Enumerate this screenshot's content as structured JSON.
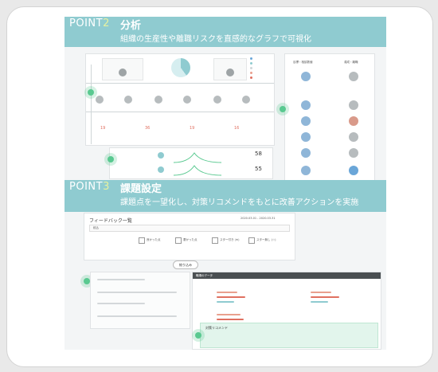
{
  "point2": {
    "label": "POINT",
    "num": "2",
    "title": "分析",
    "subtitle": "組織の生産性や離職リスクを直感的なグラフで可視化"
  },
  "point3": {
    "label": "POINT",
    "num": "3",
    "title": "課題設定",
    "subtitle": "課題点を一望化し、対策リコメンドをもとに改善アクションを実施"
  },
  "feedback": {
    "header": "フィードバック一覧",
    "date_range": "2020.03.01 - 2020.03.31",
    "search_label": "絞込",
    "options": [
      "良かった点",
      "悪かった点",
      "スター付き (★)",
      "スター無し (☆)"
    ],
    "apply_button": "絞り込み"
  },
  "analysis": {
    "stats": [
      "58",
      "55"
    ],
    "right_header_a": "目標・相談数値",
    "right_header_b": "達成・離職"
  },
  "issue_panel": {
    "header": "職場のデータ",
    "rec_title": "対策リコメンド"
  }
}
